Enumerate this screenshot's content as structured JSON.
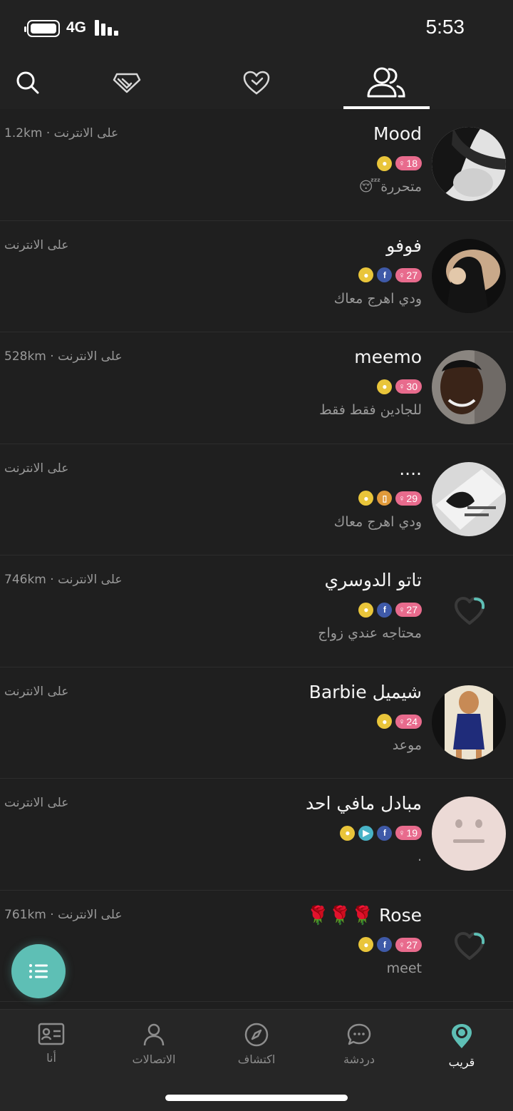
{
  "status_bar": {
    "network": "4G",
    "time": "5:53"
  },
  "top_tabs": [
    {
      "icon": "search-icon"
    },
    {
      "icon": "diamond-icon"
    },
    {
      "icon": "heart-icon"
    },
    {
      "icon": "people-icon",
      "active": true
    }
  ],
  "users": [
    {
      "name": "Mood",
      "age": "18",
      "badges": [
        "fire"
      ],
      "bio": "متحررة😴",
      "meta": "1.2km · على الانترنت"
    },
    {
      "name": "فوفو",
      "age": "27",
      "badges": [
        "facebook",
        "fire"
      ],
      "bio": "ودي اهرج معاك",
      "meta": "على الانترنت"
    },
    {
      "name": "meemo",
      "age": "30",
      "badges": [
        "fire"
      ],
      "bio": "للجادين  فقط فقط",
      "meta": "528km · على الانترنت"
    },
    {
      "name": "....",
      "age": "29",
      "badges": [
        "phone",
        "fire"
      ],
      "bio": "ودي اهرج معاك",
      "meta": "على الانترنت"
    },
    {
      "name": "تاتو الدوسري",
      "age": "27",
      "badges": [
        "facebook",
        "fire"
      ],
      "bio": "محتاجه عندي زواج",
      "meta": "746km · على الانترنت"
    },
    {
      "name": "شيميل Barbie",
      "age": "24",
      "badges": [
        "fire"
      ],
      "bio": "موعد",
      "meta": "على الانترنت"
    },
    {
      "name": "مبادل مافي احد",
      "age": "19",
      "badges": [
        "facebook",
        "video",
        "fire"
      ],
      "bio": ".",
      "meta": "على الانترنت"
    },
    {
      "name": "Rose 🌹🌹🌹",
      "age": "27",
      "badges": [
        "facebook",
        "fire"
      ],
      "bio": "meet",
      "meta": "761km · على الانترنت"
    }
  ],
  "bottom_nav": [
    {
      "label": "أنا",
      "icon": "profile-card-icon"
    },
    {
      "label": "الاتصالات",
      "icon": "person-icon"
    },
    {
      "label": "اكتشاف",
      "icon": "compass-icon"
    },
    {
      "label": "دردشة",
      "icon": "chat-bubble-icon"
    },
    {
      "label": "قريب",
      "icon": "location-pin-icon",
      "active": true
    }
  ],
  "colors": {
    "accent": "#5ebfb5",
    "age_badge": "#e86b8d",
    "fire_badge": "#e9c53a",
    "facebook_badge": "#3f5aa8"
  }
}
